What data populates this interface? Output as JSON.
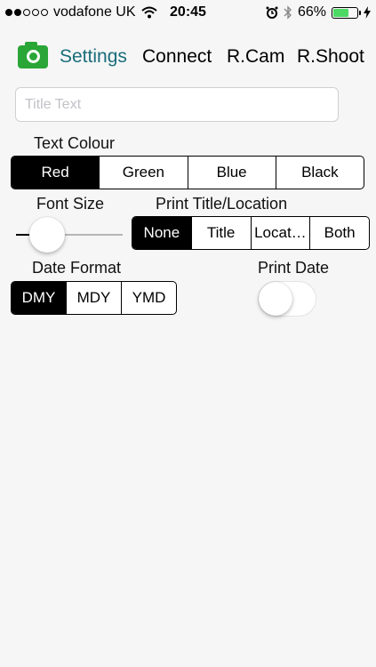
{
  "status_bar": {
    "carrier": "vodafone UK",
    "time": "20:45",
    "battery_percent": "66%",
    "battery_level": 0.66,
    "signal_bars_filled": 2,
    "signal_bars_total": 5
  },
  "nav": {
    "app_icon": "camera-icon",
    "items": [
      {
        "label": "Settings",
        "active": true
      },
      {
        "label": "Connect"
      },
      {
        "label": "R.Cam"
      },
      {
        "label": "R.Shoot"
      }
    ]
  },
  "title_field": {
    "placeholder": "Title Text",
    "value": ""
  },
  "text_colour": {
    "label": "Text Colour",
    "options": [
      "Red",
      "Green",
      "Blue",
      "Black"
    ],
    "selected": "Red"
  },
  "font_size": {
    "label": "Font Size",
    "value_fraction": 0.15
  },
  "print_title": {
    "label": "Print Title/Location",
    "options": [
      "None",
      "Title",
      "Locat…",
      "Both"
    ],
    "selected": "None"
  },
  "date_format": {
    "label": "Date Format",
    "options": [
      "DMY",
      "MDY",
      "YMD"
    ],
    "selected": "DMY"
  },
  "print_date": {
    "label": "Print Date",
    "on": false
  },
  "colors": {
    "accent_green": "#2aa637",
    "active_tab": "#1a6d7a",
    "battery": "#4cd964"
  }
}
